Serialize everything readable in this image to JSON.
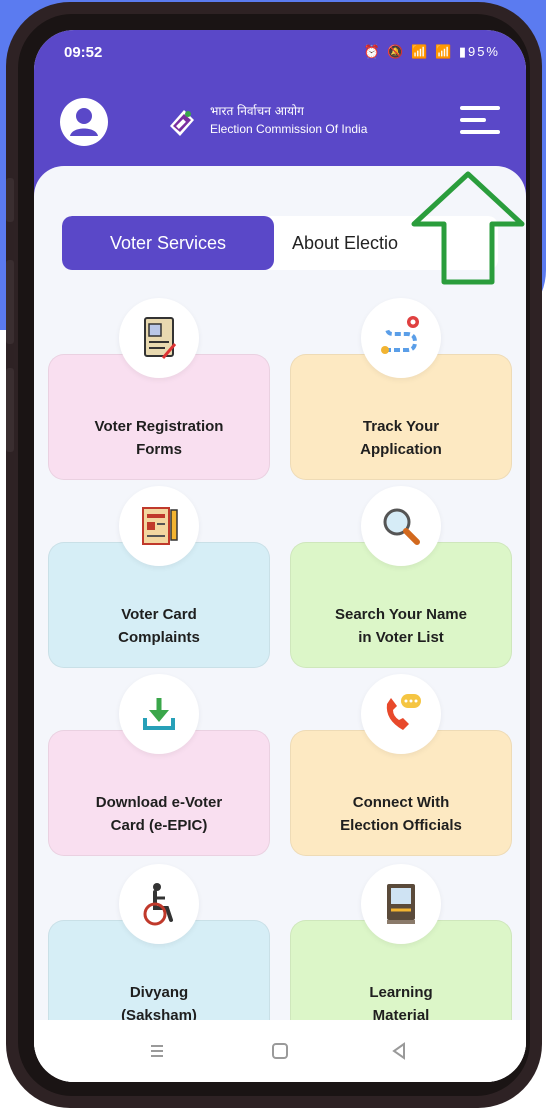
{
  "status_bar": {
    "time": "09:52",
    "icons": "⏰ 🔕 📶 📶 ▮95%",
    "battery": "95%"
  },
  "header": {
    "brand_hindi": "भारत निर्वाचन आयोग",
    "brand_english": "Election Commission Of India",
    "bg_color": "#5a48c8"
  },
  "tabs": [
    {
      "label": "Voter Services",
      "active": true
    },
    {
      "label": "About Electio",
      "active": false
    }
  ],
  "services": [
    {
      "label": "Voter Registration\nForms",
      "bg": "#f9dff0",
      "icon": "registration-form-icon"
    },
    {
      "label": "Track Your\nApplication",
      "bg": "#fde9c2",
      "icon": "route-tracker-icon"
    },
    {
      "label": "Voter Card\nComplaints",
      "bg": "#d6eef6",
      "icon": "complaint-notepad-icon"
    },
    {
      "label": "Search Your Name\nin Voter List",
      "bg": "#dcf6c8",
      "icon": "magnifier-icon"
    },
    {
      "label": "Download e-Voter\nCard (e-EPIC)",
      "bg": "#f9dff0",
      "icon": "download-icon"
    },
    {
      "label": "Connect With\nElection Officials",
      "bg": "#fde9c2",
      "icon": "phone-chat-icon"
    },
    {
      "label": "Divyang\n(Saksham)",
      "bg": "#d6eef6",
      "icon": "wheelchair-icon"
    },
    {
      "label": "Learning\nMaterial",
      "bg": "#dcf6c8",
      "icon": "book-icon"
    }
  ],
  "nav_bar": {
    "icons": [
      "recent-apps-icon",
      "home-icon",
      "back-icon"
    ]
  },
  "overlay": {
    "arrow_color": "#2a9d3c"
  }
}
